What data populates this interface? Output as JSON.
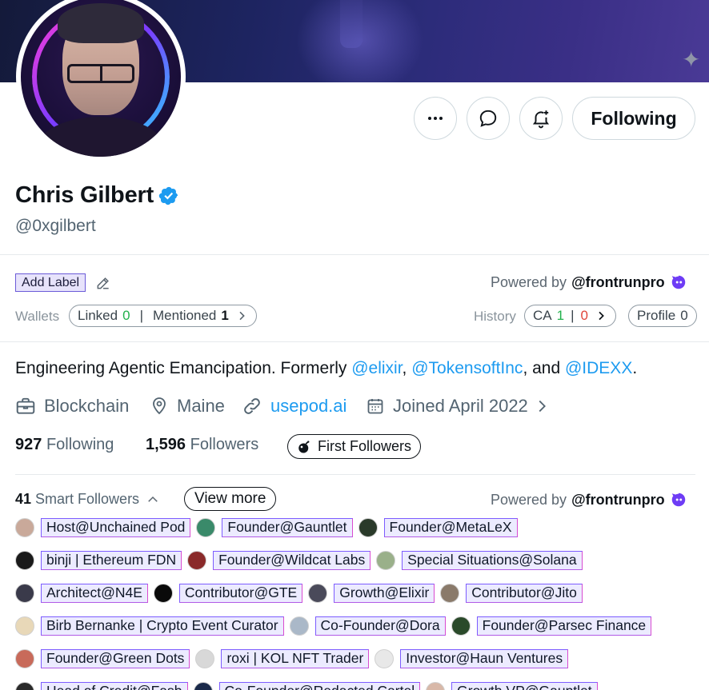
{
  "profile": {
    "name": "Chris Gilbert",
    "handle": "@0xgilbert",
    "follow_button": "Following",
    "bio_text": "Engineering Agentic Emancipation. Formerly ",
    "bio_links": [
      "@elixir",
      "@TokensoftInc",
      "@IDEXX"
    ],
    "bio_sep1": ", ",
    "bio_sep2": ", and ",
    "bio_end": ".",
    "category": "Blockchain",
    "location": "Maine",
    "website": "usepod.ai",
    "joined": "Joined April 2022",
    "following_count": "927",
    "following_label": "Following",
    "followers_count": "1,596",
    "followers_label": "Followers",
    "first_followers_button": "First Followers"
  },
  "frontrun": {
    "add_label": "Add Label",
    "powered_by": "Powered by",
    "powered_brand": "@frontrunpro",
    "wallets_label": "Wallets",
    "linked_label": "Linked",
    "linked_count": "0",
    "mentioned_label": "Mentioned",
    "mentioned_count": "1",
    "history_label": "History",
    "ca_label": "CA",
    "ca_green": "1",
    "ca_red": "0",
    "profile_label": "Profile",
    "profile_count": "0"
  },
  "smart_followers": {
    "count": "41",
    "label": "Smart Followers",
    "view_more": "View more",
    "powered_by": "Powered by",
    "powered_brand": "@frontrunpro",
    "rows": [
      [
        {
          "label": "Host@Unchained Pod",
          "avatar_color": "#c9a99a"
        },
        {
          "label": "Founder@Gauntlet",
          "avatar_color": "#3a8a6a"
        },
        {
          "label": "Founder@MetaLeX",
          "avatar_color": "#2a3a2a"
        }
      ],
      [
        {
          "label": "binji | Ethereum FDN",
          "avatar_color": "#1a1a1a"
        },
        {
          "label": "Founder@Wildcat Labs",
          "avatar_color": "#8a2a2a"
        },
        {
          "label": "Special Situations@Solana",
          "avatar_color": "#9ab08a"
        }
      ],
      [
        {
          "label": "Architect@N4E",
          "avatar_color": "#3a3a4a"
        },
        {
          "label": "Contributor@GTE",
          "avatar_color": "#0a0a0a"
        },
        {
          "label": "Growth@Elixir",
          "avatar_color": "#4a4a5a"
        },
        {
          "label": "Contributor@Jito",
          "avatar_color": "#8a7a6a"
        }
      ],
      [
        {
          "label": "Birb Bernanke | Crypto Event Curator",
          "avatar_color": "#e8d8b8"
        },
        {
          "label": "Co-Founder@Dora",
          "avatar_color": "#aab8c8"
        },
        {
          "label": "Founder@Parsec Finance",
          "avatar_color": "#2a4a2a"
        }
      ],
      [
        {
          "label": "Founder@Green Dots",
          "avatar_color": "#c86a5a"
        },
        {
          "label": "roxi | KOL NFT Trader",
          "avatar_color": "#d8d8d8"
        },
        {
          "label": "Investor@Haun Ventures",
          "avatar_color": "#e8e8e8"
        }
      ],
      [
        {
          "label": "Head of Credit@Fasb",
          "avatar_color": "#2a2a2a"
        },
        {
          "label": "Co-Founder@Redacted Cartel",
          "avatar_color": "#1a2a4a"
        },
        {
          "label": "Growth VP@Gauntlet",
          "avatar_color": "#d8b8a8"
        }
      ]
    ]
  },
  "icons": {
    "more": "more-horizontal-icon",
    "message": "message-icon",
    "notify": "bell-plus-icon",
    "verified": "verified-badge-icon",
    "pencil": "pencil-icon",
    "frontrun_logo": "frontrun-logo-icon",
    "briefcase": "briefcase-icon",
    "location": "location-pin-icon",
    "link": "link-icon",
    "calendar": "calendar-icon",
    "chevron": "chevron-right-icon",
    "chevron_up": "chevron-up-icon",
    "bomb": "bomb-icon",
    "sparkle": "sparkle-icon"
  },
  "colors": {
    "link_blue": "#1d9bf0",
    "verified_blue": "#1d9bf0",
    "tag_border": "#7c5cff",
    "frontrun_purple": "#6e3cf5"
  }
}
